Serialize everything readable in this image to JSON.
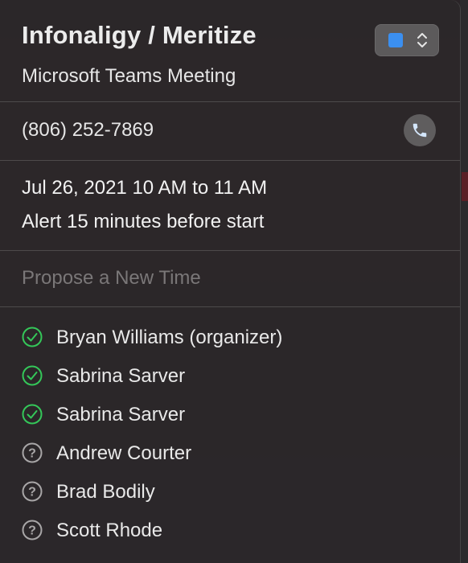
{
  "event": {
    "title": "Infonaligy / Meritize",
    "location": "Microsoft Teams Meeting",
    "calendar_color": "#3b8ff0"
  },
  "phone": {
    "number": "(806) 252-7869",
    "call_icon": "phone-icon"
  },
  "schedule": {
    "date_time": "Jul 26, 2021  10 AM to 11 AM",
    "alert": "Alert 15 minutes before start"
  },
  "propose": {
    "label": "Propose a New Time"
  },
  "attendees": [
    {
      "name": "Bryan Williams (organizer)",
      "status": "accepted"
    },
    {
      "name": "Sabrina Sarver",
      "status": "accepted"
    },
    {
      "name": "Sabrina Sarver",
      "status": "accepted"
    },
    {
      "name": "Andrew Courter",
      "status": "unknown"
    },
    {
      "name": "Brad Bodily",
      "status": "unknown"
    },
    {
      "name": "Scott Rhode",
      "status": "unknown"
    }
  ],
  "colors": {
    "accepted": "#34c759",
    "unknown": "#a8a6a7"
  }
}
